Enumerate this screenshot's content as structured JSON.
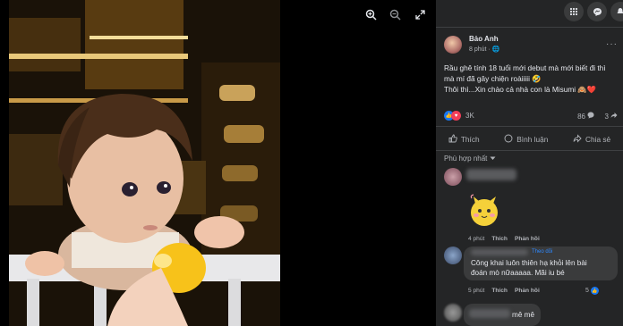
{
  "viewer": {
    "icons": [
      "zoom-in-icon",
      "zoom-out-icon",
      "fullscreen-icon"
    ]
  },
  "topbar": {
    "icons": [
      "menu-grid-icon",
      "messenger-icon",
      "notifications-icon"
    ]
  },
  "post": {
    "author": "Bảo Anh",
    "time": "8 phút · ",
    "caption_line1": "Rầu ghê tính 18 tuổi mới debut mà mới biết đi thì mà mí đã gây chiện roàiiiii 🤣",
    "caption_line2": "Thôi thì...Xin chào cả nhà con là Misumi 🙈❤️",
    "reaction_count": "3K",
    "comment_count": "86",
    "share_count": "3"
  },
  "actions": {
    "like": "Thích",
    "comment": "Bình luận",
    "share": "Chia sẻ"
  },
  "sort_label": "Phù hợp nhất",
  "comments": [
    {
      "time": "4 phút",
      "like": "Thích",
      "reply": "Phản hồi"
    },
    {
      "badge": "Theo dõi",
      "text": "Công khai luôn thiên hạ khỏi lên bài đoán mò nữaaaaa. Mãi iu bé",
      "time": "5 phút",
      "like": "Thích",
      "reply": "Phản hồi",
      "reactions": "5"
    },
    {
      "text": "mê mê"
    }
  ],
  "colors": {
    "panel_bg": "#242526",
    "bubble_bg": "#3a3b3c",
    "accent": "#1877f2",
    "love": "#f33e58"
  }
}
